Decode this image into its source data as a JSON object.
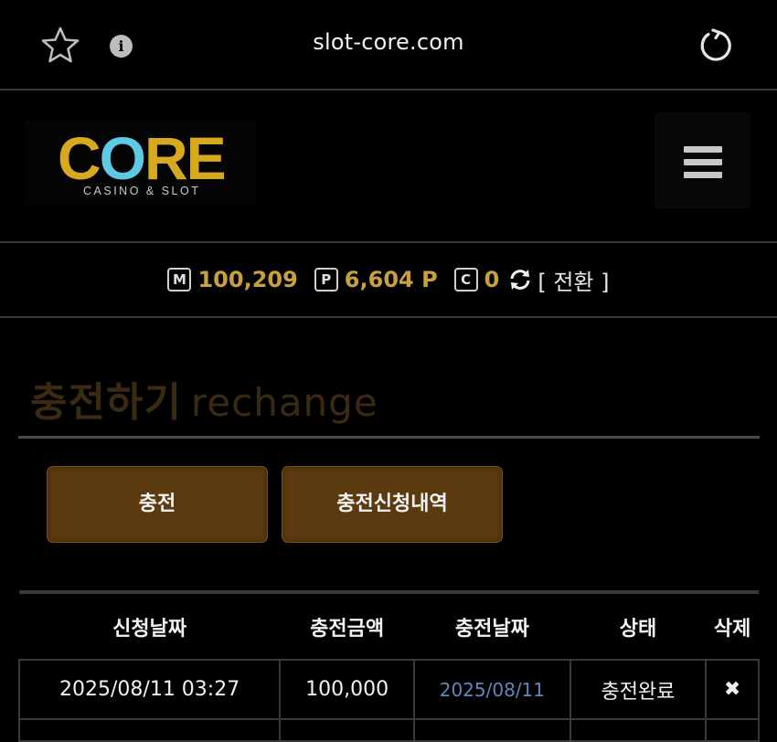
{
  "browser": {
    "url": "slot-core.com"
  },
  "logo": {
    "main_text_a": "C",
    "main_text_o": "O",
    "main_text_b": "RE",
    "subtitle": "CASINO & SLOT"
  },
  "balance": {
    "money_badge": "M",
    "money_value": "100,209",
    "point_badge": "P",
    "point_value": "6,604 P",
    "coin_badge": "C",
    "coin_value": "0",
    "swap_label": "[ 전환 ]"
  },
  "page": {
    "title_ko": "충전하기",
    "title_en": "rechange"
  },
  "actions": {
    "charge_label": "충전",
    "history_label": "충전신청내역"
  },
  "table": {
    "headers": [
      "신청날짜",
      "충전금액",
      "충전날짜",
      "상태",
      "삭제"
    ],
    "rows": [
      {
        "request_date": "2025/08/11 03:27",
        "amount": "100,000",
        "charge_date": "2025/08/11",
        "status": "충전완료",
        "delete": "✖"
      }
    ]
  },
  "colors": {
    "accent_gold": "#c9a13a",
    "button_brown": "#5c3a0f",
    "link_blue": "#5f87b9"
  }
}
